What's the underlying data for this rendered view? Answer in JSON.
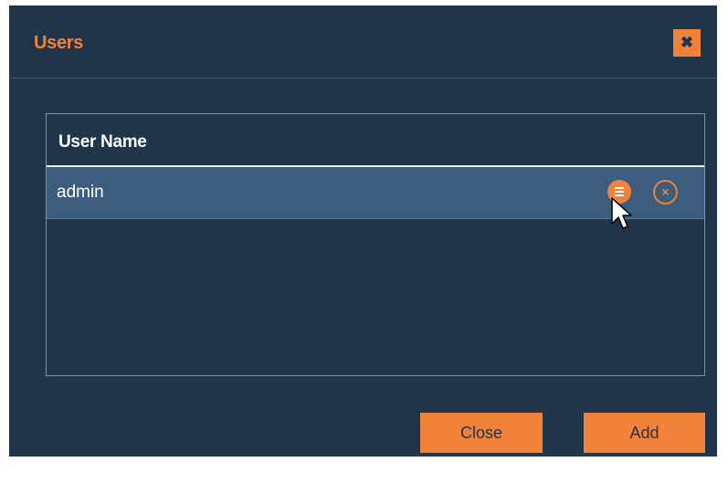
{
  "dialog": {
    "title": "Users",
    "close_icon_glyph": "✖"
  },
  "table": {
    "columns": [
      "User Name"
    ],
    "rows": [
      {
        "username": "admin",
        "selected": true
      }
    ],
    "row_actions": {
      "menu_icon": "menu-icon",
      "delete_icon": "close-circle-icon",
      "delete_glyph": "×"
    }
  },
  "footer": {
    "close_label": "Close",
    "add_label": "Add"
  },
  "colors": {
    "background": "#20344a",
    "accent": "#f0823a",
    "row_selected": "#3d5d7f",
    "text": "#ffffff"
  }
}
